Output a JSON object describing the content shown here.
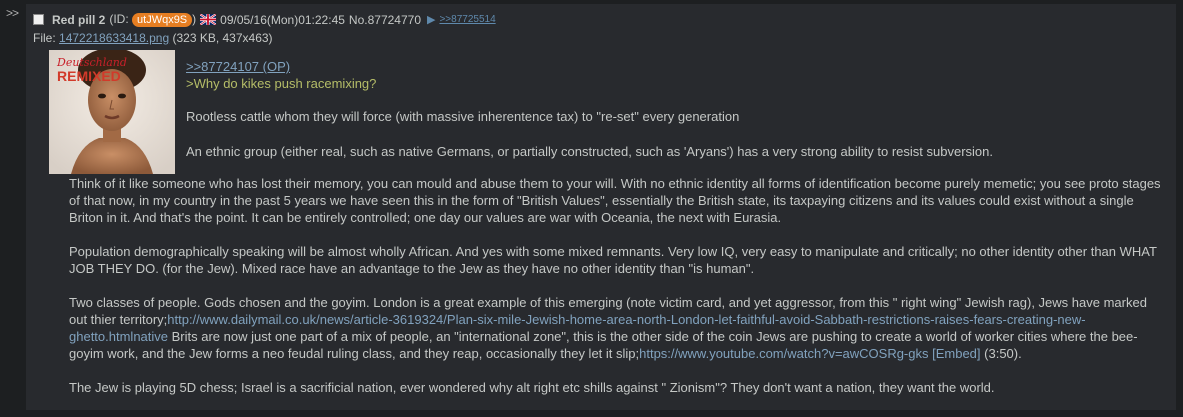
{
  "side_marker": ">>",
  "post": {
    "subject": "Red pill 2",
    "id_prefix": "(ID: ",
    "id_value": "utJWqx9S",
    "id_suffix": ")",
    "datetime": "09/05/16(Mon)01:22:45",
    "post_number": "No.87724770",
    "backlink": ">>87725514",
    "file_prefix": "File: ",
    "file_name": "1472218633418.png",
    "file_info": " (323 KB, 437x463)",
    "thumbnail": {
      "magazine_title": "Deutschland",
      "magazine_subtitle": "REMIXED"
    },
    "quote_link": ">>87724107 (OP)",
    "greentext": ">Why do kikes push racemixing?",
    "p1": "Rootless cattle whom they will force (with massive inherentence tax) to \"re-set\" every generation",
    "p2": "An ethnic group (either real, such as native Germans, or partially constructed, such as 'Aryans') has a very strong ability to resist subversion.",
    "p3": "Think of it like someone who has lost their memory, you can mould and abuse them to your will. With no ethnic identity all forms of identification become purely memetic; you see proto stages of that now, in my country in the past 5 years we have seen this in the form of \"British Values\", essentially the British state, its taxpaying citizens and its values could exist without a single Briton in it. And that's the point. It can be entirely controlled; one day our values are war with Oceania, the next with Eurasia.",
    "p4": "Population demographically speaking will be almost wholly African. And yes with some mixed remnants. Very low IQ, very easy to manipulate and critically; no other identity other than WHAT JOB THEY DO. (for the Jew). Mixed race have an advantage to the Jew as they have no other identity than \"is human\".",
    "p5_a": "Two classes of people. Gods chosen and the goyim. London is a great example of this emerging (note victim card, and yet aggressor, from this \" right wing\" Jewish rag), Jews have marked out thier territory;",
    "p5_link1": "http://www.dailymail.co.uk/news/article-3619324/Plan-six-mile-Jewish-home-area-north-London-let-faithful-avoid-Sabbath-restrictions-raises-fears-creating-new-ghetto.htmlnative",
    "p5_b": " Brits are now just one part of a mix of people, an \"international zone\", this is the other side of the coin Jews are pushing to create a world of worker cities where the bee-goyim work, and the Jew forms a neo feudal ruling class, and they reap, occasionally they let it slip;",
    "p5_link2": "https://www.youtube.com/watch?v=awCOSRg-gks",
    "p5_embed": " [Embed]",
    "p5_duration": " (3:50).",
    "p6": "The Jew is playing 5D chess; Israel is a sacrificial nation, ever wondered why alt right etc shills against \" Zionism\"? They don't want a nation, they want the world."
  },
  "colors": {
    "background": "#1d1f21",
    "post_background": "#282a2e",
    "text": "#c5c8c6",
    "link": "#81a2be",
    "greentext": "#b5bd68",
    "id_badge": "#e67e22"
  }
}
